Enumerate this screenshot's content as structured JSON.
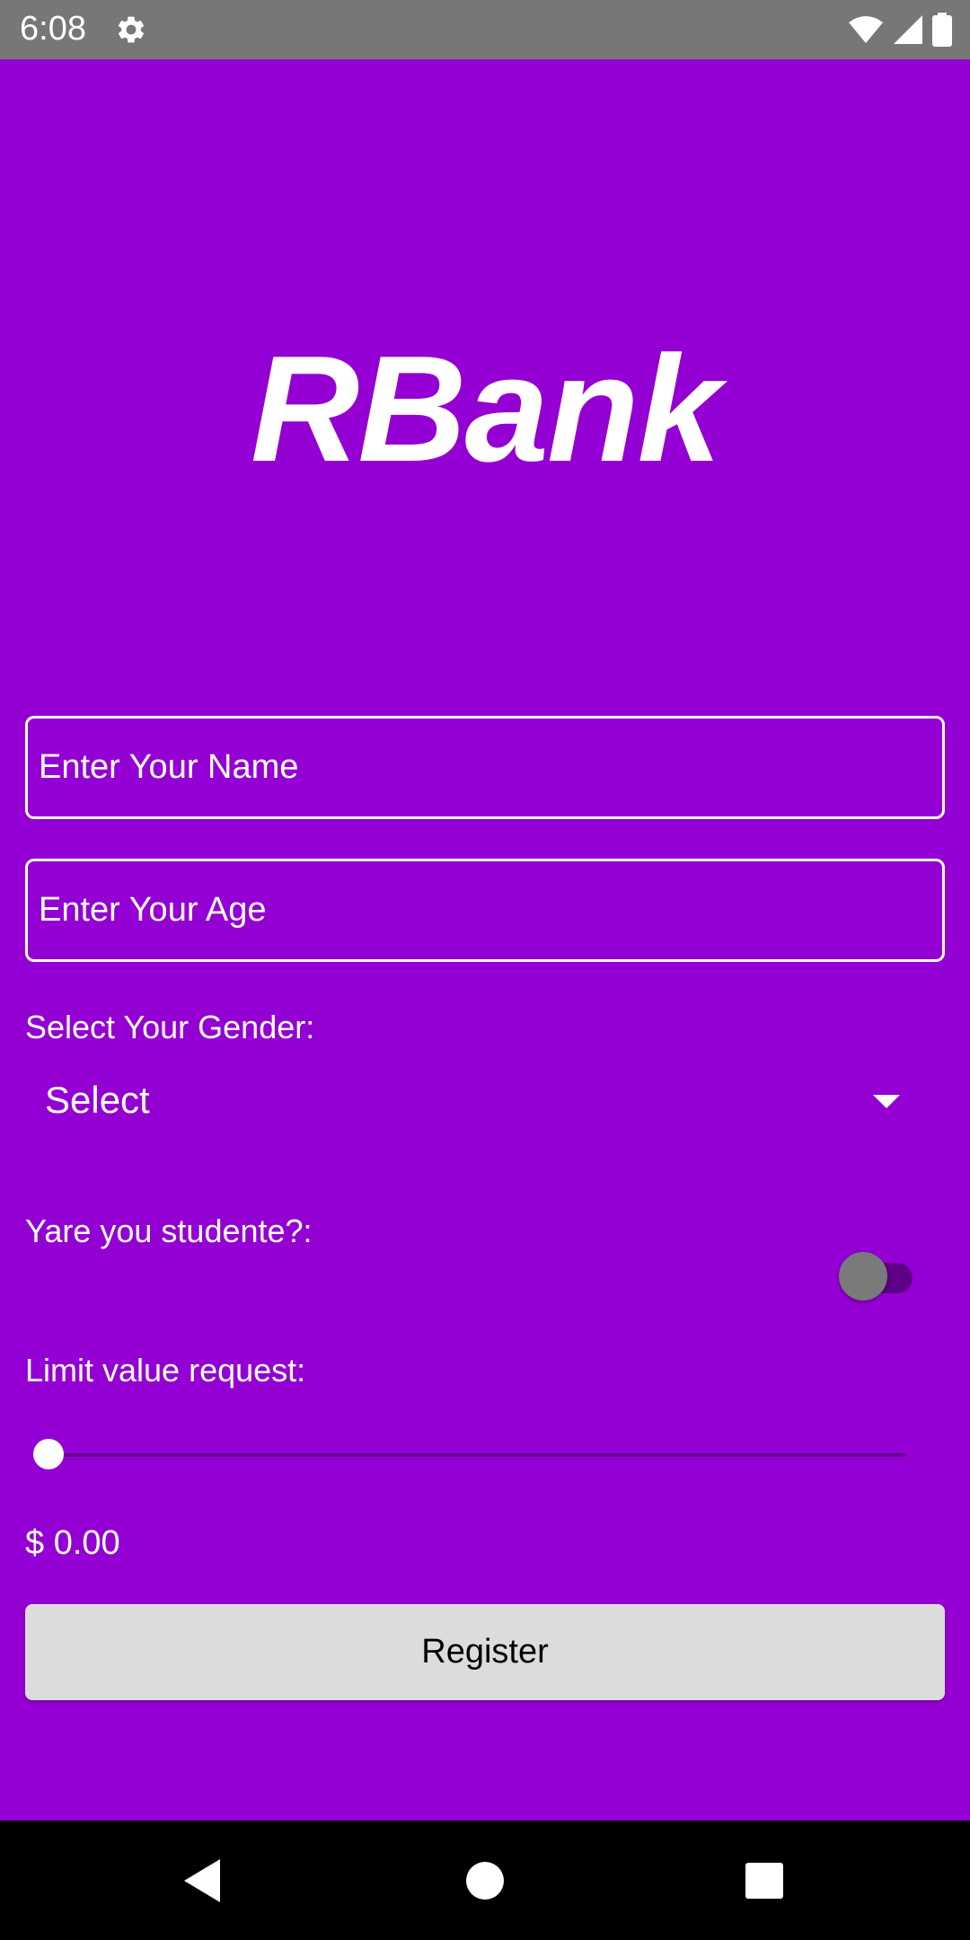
{
  "status_bar": {
    "time": "6:08",
    "icons": [
      "gear-icon",
      "wifi-icon",
      "signal-icon",
      "battery-icon"
    ]
  },
  "app": {
    "logo": "RBank"
  },
  "form": {
    "name_placeholder": "Enter Your Name",
    "age_placeholder": "Enter Your Age",
    "gender_label": "Select Your Gender:",
    "gender_selected": "Select",
    "student_label": "Yare you studente?:",
    "student_switch_on": false,
    "limit_label": "Limit value request:",
    "limit_slider_fraction": 0.0,
    "limit_amount": "$ 0.00",
    "register_label": "Register"
  },
  "nav_bar": {
    "buttons": [
      "back-icon",
      "home-icon",
      "recents-icon"
    ]
  },
  "colors": {
    "background": "#9400D3",
    "status_bar": "#777777",
    "button": "#DCDCDC",
    "text": "#FFFFFF"
  }
}
